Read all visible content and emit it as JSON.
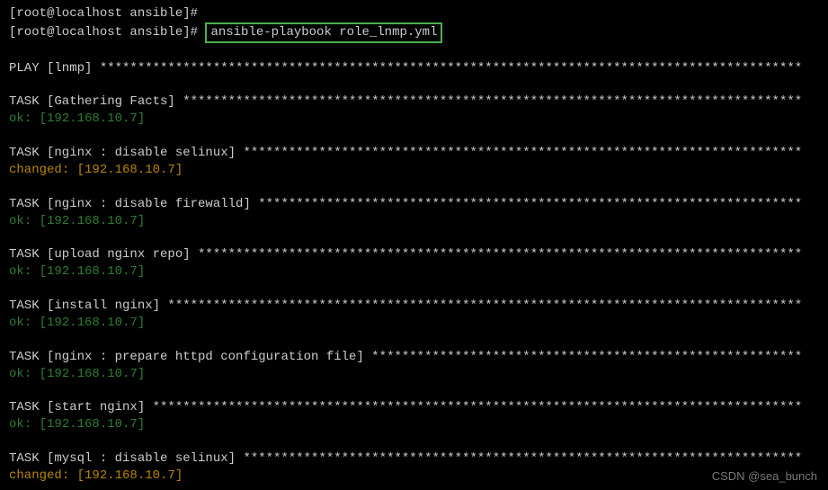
{
  "prompt1": "[root@localhost ansible]#",
  "prompt2": "[root@localhost ansible]# ",
  "command": "ansible-playbook role_lnmp.yml",
  "play_header": "PLAY [lnmp] *********************************************************************************************",
  "tasks": [
    {
      "header": "TASK [Gathering Facts] **********************************************************************************",
      "status": "ok",
      "host": "[192.168.10.7]"
    },
    {
      "header": "TASK [nginx : disable selinux] **************************************************************************",
      "status": "changed",
      "host": "[192.168.10.7]"
    },
    {
      "header": "TASK [nginx : disable firewalld] ************************************************************************",
      "status": "ok",
      "host": "[192.168.10.7]"
    },
    {
      "header": "TASK [upload nginx repo] ********************************************************************************",
      "status": "ok",
      "host": "[192.168.10.7]"
    },
    {
      "header": "TASK [install nginx] ************************************************************************************",
      "status": "ok",
      "host": "[192.168.10.7]"
    },
    {
      "header": "TASK [nginx : prepare httpd configuration file] *********************************************************",
      "status": "ok",
      "host": "[192.168.10.7]"
    },
    {
      "header": "TASK [start nginx] **************************************************************************************",
      "status": "ok",
      "host": "[192.168.10.7]"
    },
    {
      "header": "TASK [mysql : disable selinux] **************************************************************************",
      "status": "changed",
      "host": "[192.168.10.7]"
    }
  ],
  "watermark": "CSDN @sea_bunch"
}
